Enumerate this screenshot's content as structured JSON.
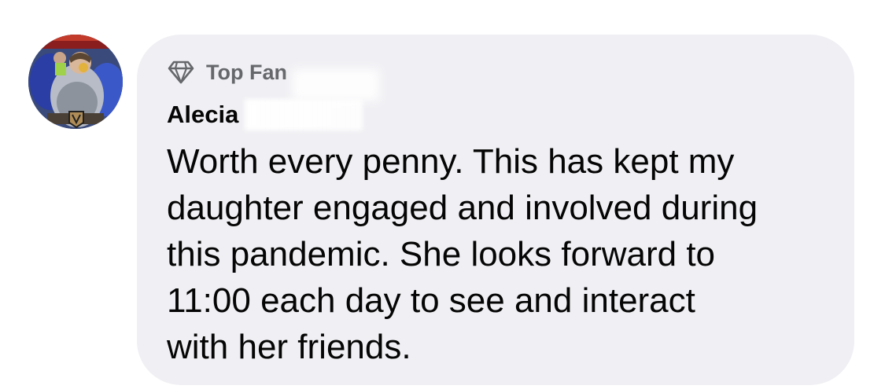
{
  "comment": {
    "badge": {
      "icon": "diamond-icon",
      "label": "Top Fan"
    },
    "author": {
      "name": "Alecia"
    },
    "lines": [
      "Worth every penny. This has kept my",
      "daughter engaged and involved during",
      "this pandemic. She looks forward to",
      "11:00 each day to see and interact",
      "with her friends."
    ]
  },
  "colors": {
    "bubble": "#f0f0f4",
    "text": "#050505",
    "secondary_text": "#65676b"
  }
}
